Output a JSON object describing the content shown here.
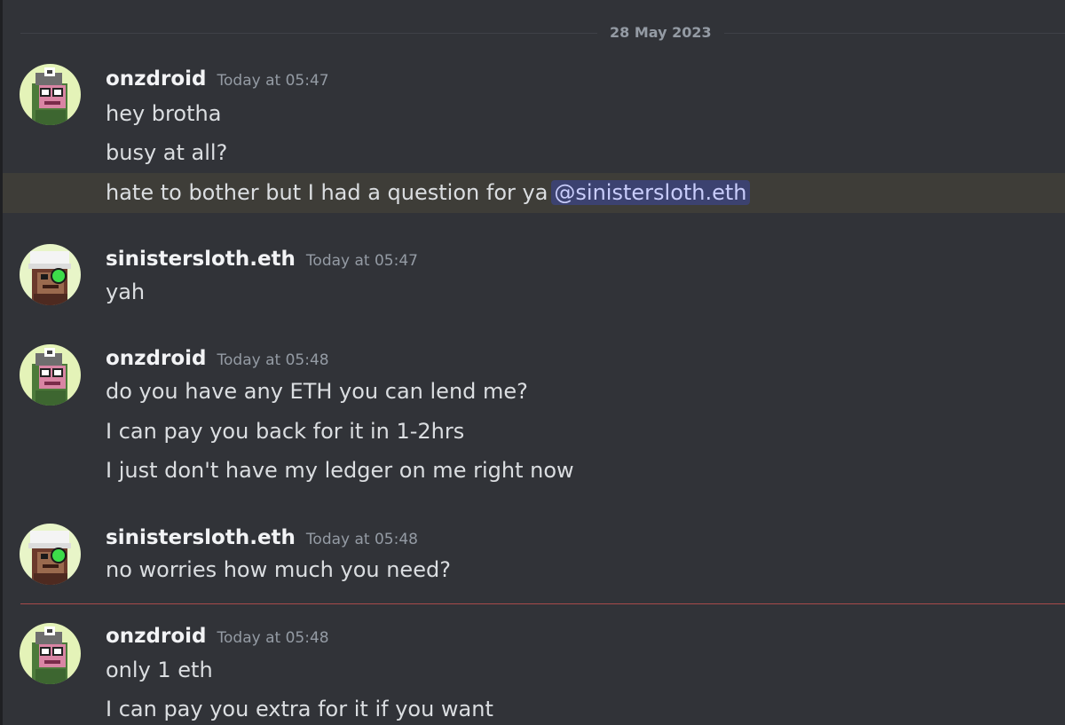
{
  "date_divider": "28 May 2023",
  "messages": [
    {
      "author": "onzdroid",
      "time": "Today at 05:47",
      "lines": [
        "hey brotha",
        "busy at all?",
        "hate to bother but I had a question for ya"
      ],
      "mention": "@sinistersloth.eth"
    },
    {
      "author": "sinistersloth.eth",
      "time": "Today at 05:47",
      "lines": [
        "yah"
      ]
    },
    {
      "author": "onzdroid",
      "time": "Today at 05:48",
      "lines": [
        "do you have any ETH you can lend me?",
        "I can pay you back for it in 1-2hrs",
        "I just don't have my ledger on me right now"
      ]
    },
    {
      "author": "sinistersloth.eth",
      "time": "Today at 05:48",
      "lines": [
        "no worries how much you need?"
      ]
    },
    {
      "author": "onzdroid",
      "time": "Today at 05:48",
      "lines": [
        "only 1 eth",
        "I can pay you extra for it if you want"
      ]
    }
  ],
  "avatars": {
    "onzdroid": "ape-avatar-icon",
    "sinistersloth.eth": "ape-avatar-icon"
  },
  "colors": {
    "background": "#313338",
    "highlight": "#3e3d38",
    "mention_bg": "#3c4270",
    "mention_text": "#c9cdfb",
    "new_divider": "#a84a4a"
  }
}
